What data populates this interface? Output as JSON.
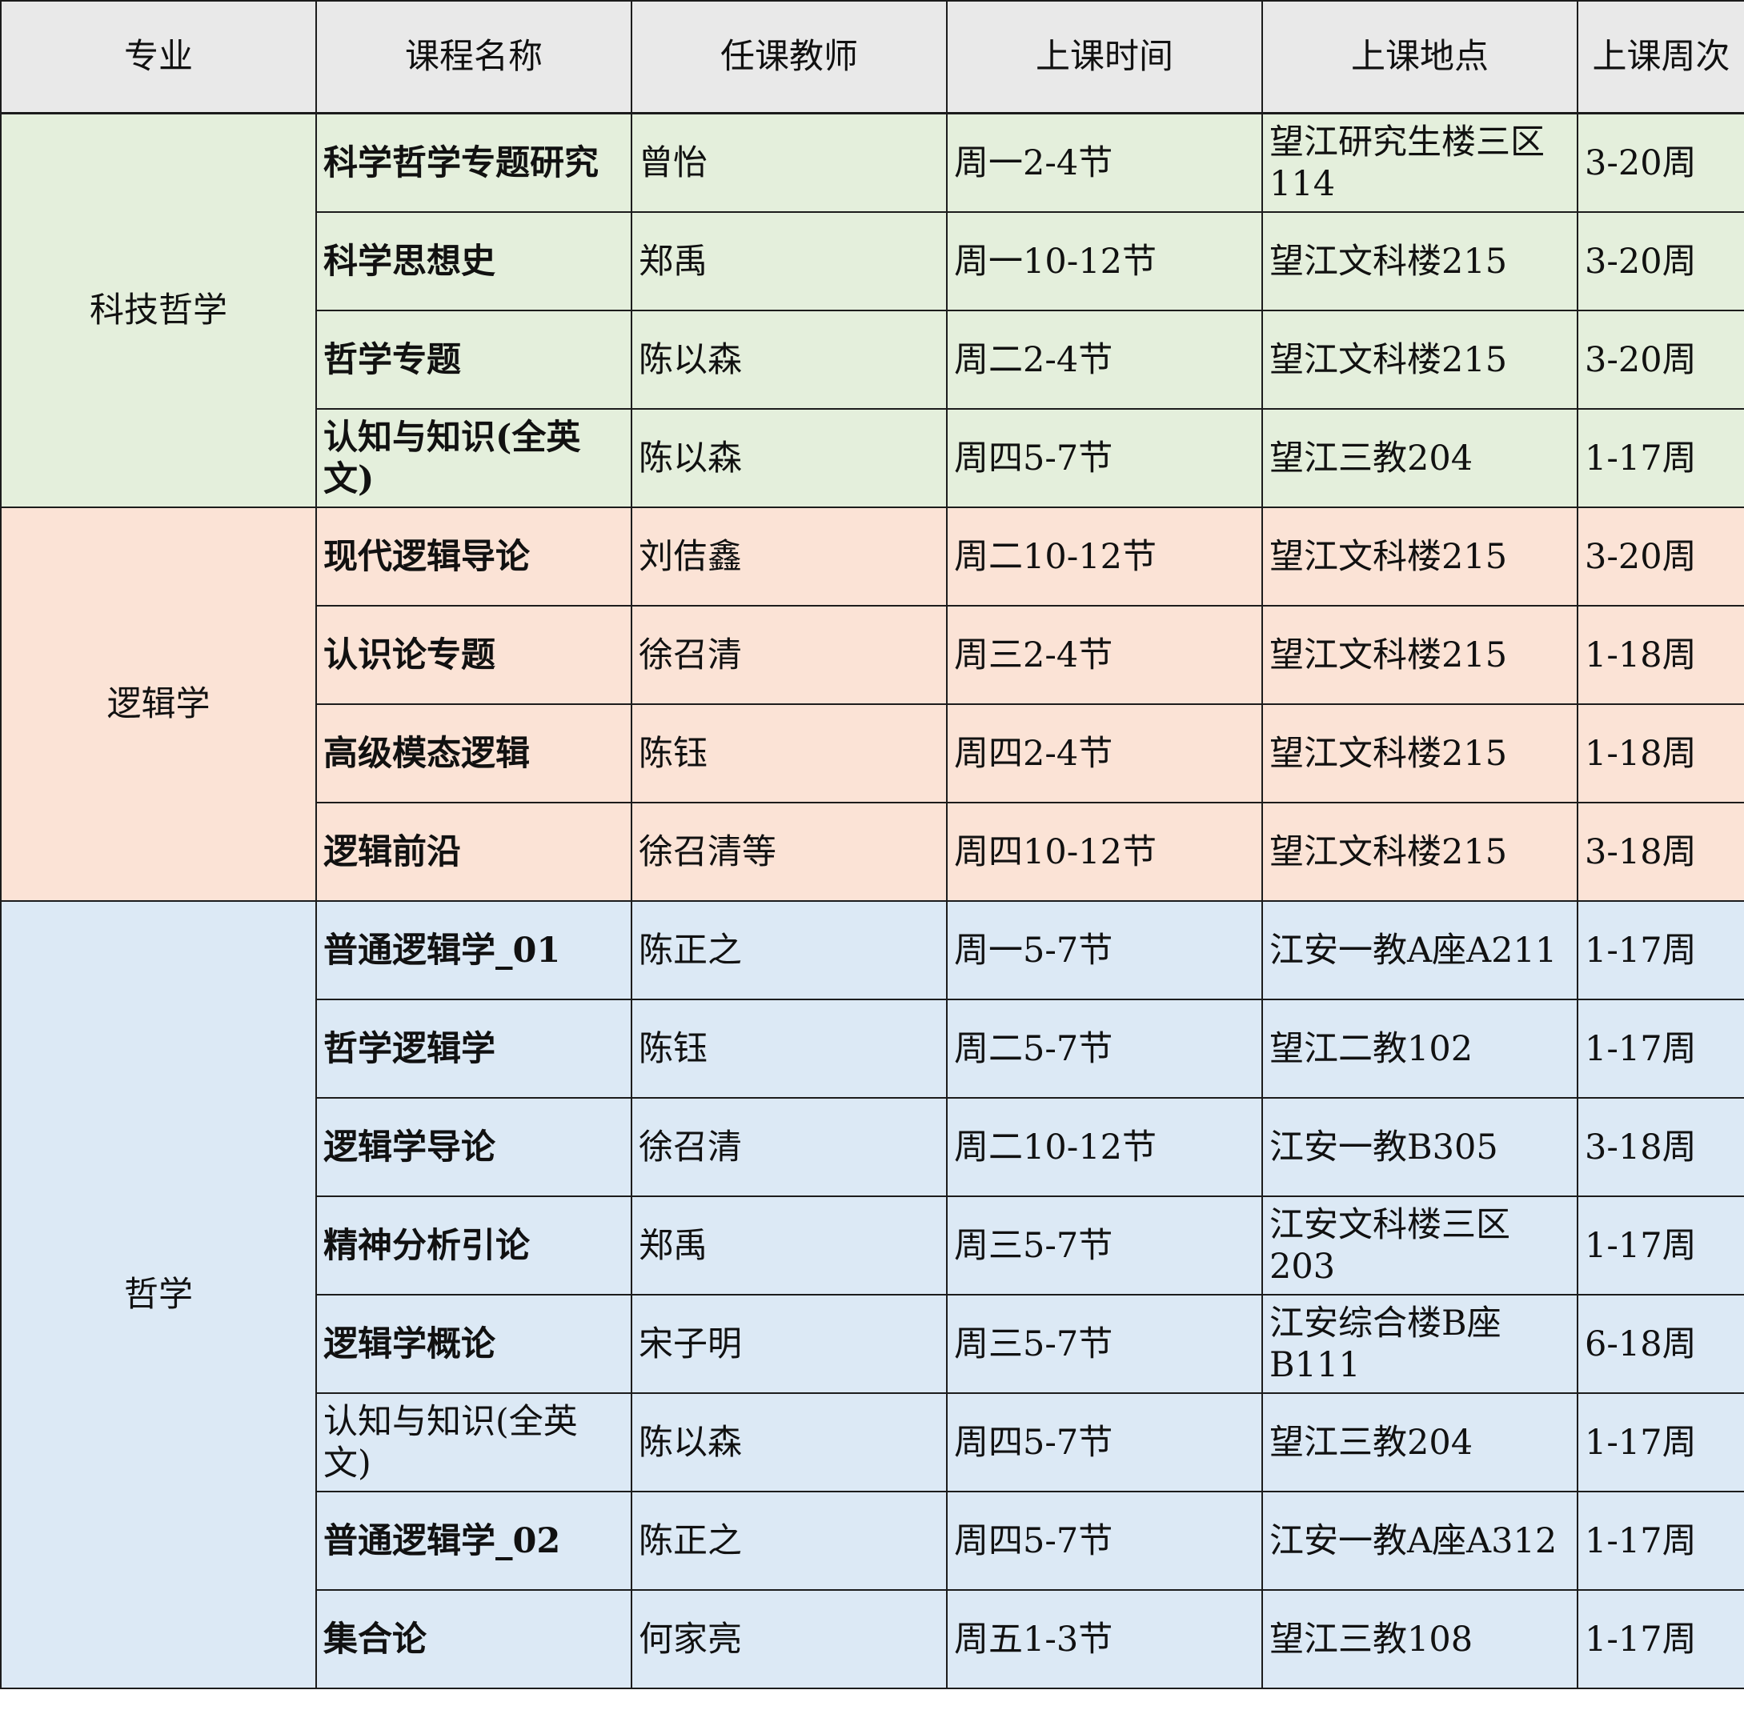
{
  "headers": [
    "专业",
    "课程名称",
    "任课教师",
    "上课时间",
    "上课地点",
    "上课周次"
  ],
  "groups": [
    {
      "major": "科技哲学",
      "color": "#e4efdc",
      "rows": [
        {
          "course": "科学哲学专题研究",
          "teacher": "曾怡",
          "time": "周一2-4节",
          "place": "望江研究生楼三区114",
          "weeks": "3-20周"
        },
        {
          "course": "科学思想史",
          "teacher": "郑禹",
          "time": "周一10-12节",
          "place": "望江文科楼215",
          "weeks": "3-20周"
        },
        {
          "course": "哲学专题",
          "teacher": "陈以森",
          "time": "周二2-4节",
          "place": "望江文科楼215",
          "weeks": "3-20周"
        },
        {
          "course": "认知与知识(全英文)",
          "teacher": "陈以森",
          "time": "周四5-7节",
          "place": "望江三教204",
          "weeks": "1-17周"
        }
      ]
    },
    {
      "major": "逻辑学",
      "color": "#fbe3d6",
      "rows": [
        {
          "course": "现代逻辑导论",
          "teacher": "刘佶鑫",
          "time": "周二10-12节",
          "place": "望江文科楼215",
          "weeks": "3-20周"
        },
        {
          "course": "认识论专题",
          "teacher": "徐召清",
          "time": "周三2-4节",
          "place": "望江文科楼215",
          "weeks": "1-18周"
        },
        {
          "course": "高级模态逻辑",
          "teacher": "陈钰",
          "time": "周四2-4节",
          "place": "望江文科楼215",
          "weeks": "1-18周"
        },
        {
          "course": "逻辑前沿",
          "teacher": "徐召清等",
          "time": "周四10-12节",
          "place": "望江文科楼215",
          "weeks": "3-18周"
        }
      ]
    },
    {
      "major": "哲学",
      "color": "#dce9f5",
      "rows": [
        {
          "course": "普通逻辑学_01",
          "teacher": "陈正之",
          "time": "周一5-7节",
          "place": "江安一教A座A211",
          "weeks": "1-17周"
        },
        {
          "course": "哲学逻辑学",
          "teacher": "陈钰",
          "time": "周二5-7节",
          "place": "望江二教102",
          "weeks": "1-17周"
        },
        {
          "course": "逻辑学导论",
          "teacher": "徐召清",
          "time": "周二10-12节",
          "place": "江安一教B305",
          "weeks": "3-18周"
        },
        {
          "course": "精神分析引论",
          "teacher": "郑禹",
          "time": "周三5-7节",
          "place": "江安文科楼三区203",
          "weeks": "1-17周"
        },
        {
          "course": "逻辑学概论",
          "teacher": "宋子明",
          "time": "周三5-7节",
          "place": "江安综合楼B座B111",
          "weeks": "6-18周"
        },
        {
          "course": "认知与知识(全英文)",
          "teacher": "陈以森",
          "time": "周四5-7节",
          "place": "望江三教204",
          "weeks": "1-17周"
        },
        {
          "course": "普通逻辑学_02",
          "teacher": "陈正之",
          "time": "周四5-7节",
          "place": "江安一教A座A312",
          "weeks": "1-17周"
        },
        {
          "course": "集合论",
          "teacher": "何家亮",
          "time": "周五1-3节",
          "place": "望江三教108",
          "weeks": "1-17周"
        }
      ]
    }
  ]
}
